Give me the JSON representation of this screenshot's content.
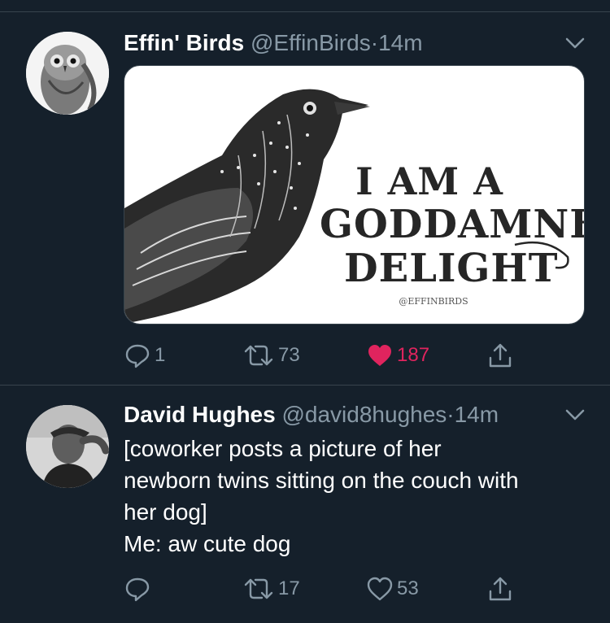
{
  "tweets": [
    {
      "name": "Effin' Birds",
      "handle": "@EffinBirds",
      "separator": "·",
      "time": "14m",
      "avatar_icon": "owl-avatar-icon",
      "media": {
        "line1": "I AM A",
        "line2": "GODDAMNED",
        "line3": "DELIGHT",
        "credit": "@EFFINBIRDS"
      },
      "replies": "1",
      "retweets": "73",
      "likes": "187",
      "liked": true
    },
    {
      "name": "David Hughes",
      "handle": "@david8hughes",
      "separator": "·",
      "time": "14m",
      "avatar_icon": "person-avatar-icon",
      "text_lines": [
        "[coworker posts a picture of her",
        "newborn twins sitting on the couch with",
        "her dog]",
        "Me: aw cute dog"
      ],
      "replies": "",
      "retweets": "17",
      "likes": "53",
      "liked": false
    }
  ],
  "colors": {
    "background": "#15202b",
    "divider": "#38444d",
    "muted": "#8899a6",
    "like": "#e0245e"
  }
}
